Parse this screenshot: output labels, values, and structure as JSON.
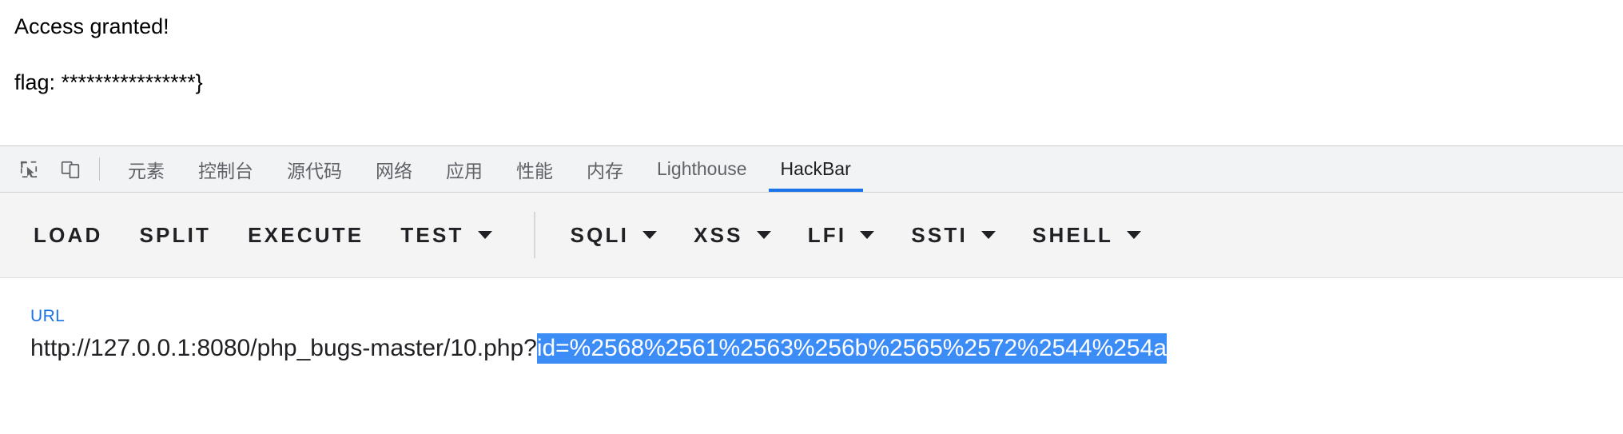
{
  "page": {
    "line1": "Access granted!",
    "flag_label": "flag: ",
    "flag_value": "****************}"
  },
  "devtools": {
    "icons": [
      {
        "name": "inspect-element-icon",
        "title": "检查元素"
      },
      {
        "name": "device-toolbar-icon",
        "title": "切换设备工具栏"
      }
    ],
    "tabs": [
      {
        "label": "元素",
        "active": false
      },
      {
        "label": "控制台",
        "active": false
      },
      {
        "label": "源代码",
        "active": false
      },
      {
        "label": "网络",
        "active": false
      },
      {
        "label": "应用",
        "active": false
      },
      {
        "label": "性能",
        "active": false
      },
      {
        "label": "内存",
        "active": false
      },
      {
        "label": "Lighthouse",
        "active": false
      },
      {
        "label": "HackBar",
        "active": true
      }
    ],
    "active_tab": "HackBar",
    "accent_color": "#1a73e8"
  },
  "hackbar": {
    "buttons": [
      {
        "label": "LOAD",
        "has_caret": false
      },
      {
        "label": "SPLIT",
        "has_caret": false
      },
      {
        "label": "EXECUTE",
        "has_caret": false
      },
      {
        "label": "TEST",
        "has_caret": true
      },
      {
        "label": "SQLI",
        "has_caret": true
      },
      {
        "label": "XSS",
        "has_caret": true
      },
      {
        "label": "LFI",
        "has_caret": true
      },
      {
        "label": "SSTI",
        "has_caret": true
      },
      {
        "label": "SHELL",
        "has_caret": true
      }
    ],
    "url_field": {
      "label": "URL",
      "value_prefix": "http://127.0.0.1:8080/php_bugs-master/10.php?",
      "value_selected": "id=%2568%2561%2563%256b%2565%2572%2544%254a",
      "full_value": "http://127.0.0.1:8080/php_bugs-master/10.php?id=%2568%2561%2563%256b%2565%2572%2544%254a",
      "selection_color": "#3b8cf7"
    }
  }
}
